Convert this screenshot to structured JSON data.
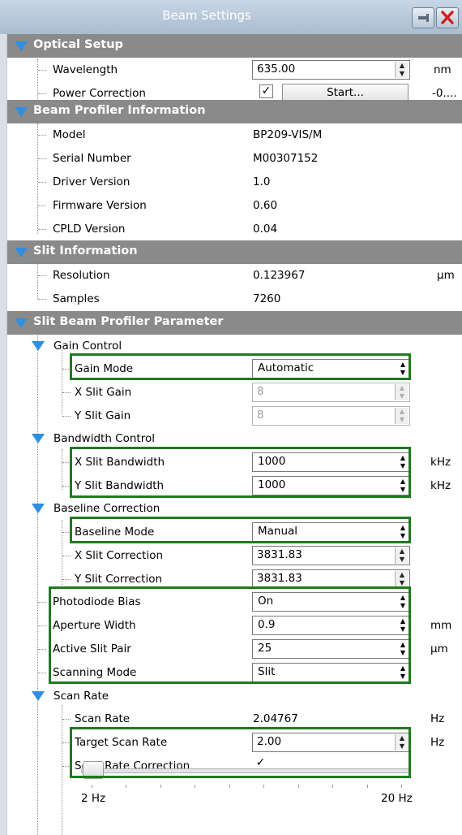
{
  "window": {
    "title": "Beam Settings"
  },
  "optical_setup": {
    "header": "Optical Setup",
    "wavelength": {
      "label": "Wavelength",
      "value": "635.00",
      "unit": "nm"
    },
    "power_correction": {
      "label": "Power Correction",
      "checked": "✓",
      "button": "Start...",
      "unit": "-0...."
    }
  },
  "profiler_info": {
    "header": "Beam Profiler Information",
    "model": {
      "label": "Model",
      "value": "BP209-VIS/M"
    },
    "serial": {
      "label": "Serial Number",
      "value": "M00307152"
    },
    "driver": {
      "label": "Driver Version",
      "value": "1.0"
    },
    "firmware": {
      "label": "Firmware Version",
      "value": "0.60"
    },
    "cpld": {
      "label": "CPLD Version",
      "value": "0.04"
    }
  },
  "slit_info": {
    "header": "Slit Information",
    "resolution": {
      "label": "Resolution",
      "value": "0.123967",
      "unit": "µm"
    },
    "samples": {
      "label": "Samples",
      "value": "7260"
    }
  },
  "slit_param": {
    "header": "Slit Beam Profiler Parameter",
    "gain_control": {
      "header": "Gain Control",
      "gain_mode": {
        "label": "Gain Mode",
        "value": "Automatic"
      },
      "x_gain": {
        "label": "X Slit Gain",
        "value": "8"
      },
      "y_gain": {
        "label": "Y Slit Gain",
        "value": "8"
      }
    },
    "bandwidth_control": {
      "header": "Bandwidth Control",
      "x_bw": {
        "label": "X Slit Bandwidth",
        "value": "1000",
        "unit": "kHz"
      },
      "y_bw": {
        "label": "Y Slit Bandwidth",
        "value": "1000",
        "unit": "kHz"
      }
    },
    "baseline_correction": {
      "header": "Baseline Correction",
      "mode": {
        "label": "Baseline Mode",
        "value": "Manual"
      },
      "x_corr": {
        "label": "X Slit Correction",
        "value": "3831.83"
      },
      "y_corr": {
        "label": "Y Slit Correction",
        "value": "3831.83"
      }
    },
    "photodiode_bias": {
      "label": "Photodiode Bias",
      "value": "On"
    },
    "aperture_width": {
      "label": "Aperture Width",
      "value": "0.9",
      "unit": "mm"
    },
    "active_slit_pair": {
      "label": "Active Slit Pair",
      "value": "25",
      "unit": "µm"
    },
    "scanning_mode": {
      "label": "Scanning Mode",
      "value": "Slit"
    },
    "scan_rate_group": {
      "header": "Scan Rate",
      "scan_rate": {
        "label": "Scan Rate",
        "value": "2.04767",
        "unit": "Hz"
      },
      "target_rate": {
        "label": "Target Scan Rate",
        "value": "2.00",
        "unit": "Hz"
      },
      "correction": {
        "label": "Scan Rate Correction",
        "checked": "✓"
      },
      "slider": {
        "min_label": "2 Hz",
        "max_label": "20 Hz",
        "value": 2
      }
    }
  },
  "colors": {
    "accent_triangle": "#2f8fe0",
    "category_bg": "#8a8a8a",
    "highlight_box": "#1f7a1f"
  }
}
